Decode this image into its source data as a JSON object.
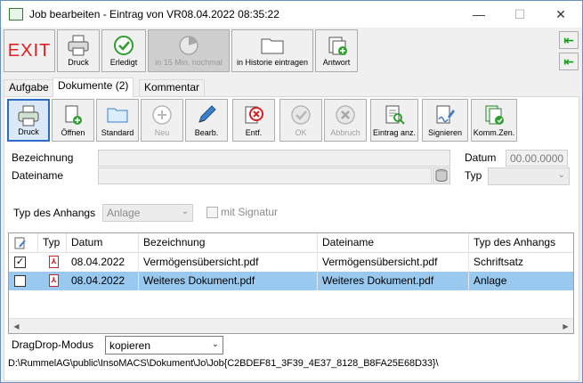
{
  "window": {
    "title": "Job bearbeiten - Eintrag von VR08.04.2022 08:35:22",
    "minimize": "—",
    "maximize": "☐",
    "close": "✕"
  },
  "toolbar_top": {
    "exit_label": "EXIT",
    "buttons": [
      {
        "label": "Druck",
        "icon": "printer-icon"
      },
      {
        "label": "Erledigt",
        "icon": "check-circle-icon"
      },
      {
        "label": "in 15 Min. nochmal",
        "icon": "clock-icon",
        "disabled": true
      },
      {
        "label": "in Historie eintragen",
        "icon": "folder-icon"
      },
      {
        "label": "Antwort",
        "icon": "reply-icon"
      }
    ],
    "side_arrows": [
      "⇤",
      "⇤"
    ]
  },
  "tabs": [
    {
      "label": "Aufgabe",
      "active": false
    },
    {
      "label": "Dokumente (2)",
      "active": true
    },
    {
      "label": "Kommentar",
      "active": false
    }
  ],
  "doc_toolbar": {
    "buttons": [
      {
        "label": "Druck",
        "icon": "printer-icon",
        "selected": true
      },
      {
        "label": "Öffnen",
        "icon": "open-document-icon"
      },
      {
        "label": "Standard",
        "icon": "folder-icon"
      },
      {
        "label": "Neu",
        "icon": "plus-circle-icon",
        "disabled": true
      },
      {
        "label": "Bearb.",
        "icon": "pencil-icon"
      },
      {
        "label": "Entf.",
        "icon": "delete-icon"
      },
      {
        "label": "OK",
        "icon": "check-circle-icon",
        "disabled": true
      },
      {
        "label": "Abbruch",
        "icon": "cancel-icon",
        "disabled": true
      },
      {
        "label": "Eintrag anz.",
        "icon": "document-search-icon"
      },
      {
        "label": "Signieren",
        "icon": "signature-icon"
      },
      {
        "label": "Komm.Zen.",
        "icon": "document-check-icon"
      }
    ]
  },
  "form": {
    "bezeichnung_label": "Bezeichnung",
    "bezeichnung_value": "",
    "dateiname_label": "Dateiname",
    "dateiname_value": "",
    "datum_label": "Datum",
    "datum_value": "00.00.0000",
    "typ_label": "Typ",
    "typ_value": "",
    "anhang_label": "Typ des Anhangs",
    "anhang_value": "Anlage",
    "signatur_label": "mit Signatur"
  },
  "grid": {
    "columns": [
      "",
      "Typ",
      "Datum",
      "Bezeichnung",
      "Dateiname",
      "Typ des Anhangs"
    ],
    "rows": [
      {
        "checked": true,
        "typ_icon": "pdf-icon",
        "datum": "08.04.2022",
        "bezeichnung": "Vermögensübersicht.pdf",
        "dateiname": "Vermögensübersicht.pdf",
        "anhang": "Schriftsatz",
        "selected": false
      },
      {
        "checked": false,
        "typ_icon": "pdf-icon",
        "datum": "08.04.2022",
        "bezeichnung": "Weiteres Dokument.pdf",
        "dateiname": "Weiteres Dokument.pdf",
        "anhang": "Anlage",
        "selected": true
      }
    ]
  },
  "dragdrop": {
    "label": "DragDrop-Modus",
    "value": "kopieren"
  },
  "path": "D:\\RummelAG\\public\\InsoMACS\\Dokument\\Jo\\Job{C2BDEF81_3F39_4E37_8128_B8FA25E68D33}\\"
}
